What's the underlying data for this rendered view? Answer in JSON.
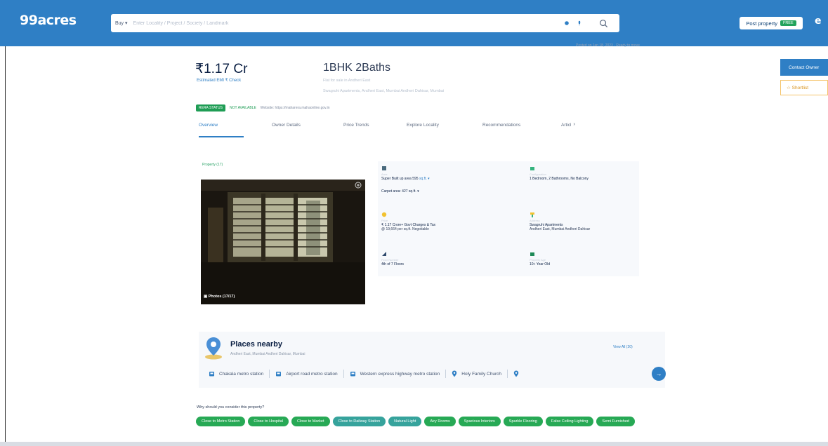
{
  "header": {
    "logo": "99acres",
    "buy_label": "Buy ▾",
    "search_placeholder": "Enter Locality / Project / Society / Landmark",
    "post_label": "Post property",
    "free_label": "FREE",
    "profile_glyph": "e"
  },
  "summary": {
    "posted": "Posted on Jan 18, 2023 · Ready to move",
    "price": "₹1.17 Cr",
    "emi": "Estimated EMI ₹ Check",
    "bhk": "1BHK 2Baths",
    "bhk_sub1": "Flat for sale in Andheri East",
    "bhk_sub2": "Swagruhi Apartments, Andheri East, Mumbai Andheri Dahisar, Mumbai",
    "rera_badge": "RERA STATUS",
    "rera_avail": "NOT AVAILABLE",
    "rera_link": "Website: https://maharera.mahaonline.gov.in"
  },
  "side": {
    "contact": "Contact Owner",
    "shortlist": "☆ Shortlist"
  },
  "tabs": [
    "Overview",
    "Owner Details",
    "Price Trends",
    "Explore Locality",
    "Recommendations",
    "Articl"
  ],
  "gallery": {
    "label": "Property (17)",
    "photos": "Photos (17/17)"
  },
  "details": {
    "area_label": "Area",
    "area_value": "Super Built up area 595",
    "area_unit": "sq.ft. ▾",
    "carpet": "Carpet area: 427 sq.ft. ▾",
    "config_label": "Configuration",
    "config_value": "1 Bedroom, 2 Bathrooms, No Balcony",
    "price_label": "Price",
    "price_value": "₹ 1.17 Crore+ Govt Charges & Tax",
    "price_sub": "@ 19,664 per sq.ft. Negotiable",
    "address_label": "Address",
    "address_value": "Swagruhi Apartments",
    "address_sub": "Andheri East, Mumbai Andheri Dahisar",
    "floor_label": "Floor Number",
    "floor_value": "4th of 7 Floors",
    "age_label": "Property Age",
    "age_value": "10+ Year Old"
  },
  "places": {
    "title": "Places nearby",
    "subtitle": "Andheri East, Mumbai Andheri Dahisar, Mumbai",
    "view_all": "View All (20)",
    "items": [
      "Chakala metro station",
      "Airport road metro station",
      "Western express highway metro station",
      "Holy Family Church"
    ]
  },
  "why": {
    "title": "Why should you consider this property?",
    "chips": [
      "Close to Metro Station",
      "Close to Hospital",
      "Close to Market",
      "Close to Railway Station",
      "Natural Light",
      "Airy Rooms",
      "Spacious Interiors",
      "Sparkle Flooring",
      "False Ceiling Lighting",
      "Semi Furnished"
    ]
  },
  "colors": {
    "brand_blue": "#2f7fc5",
    "green": "#27a955",
    "teal": "#36a39c"
  }
}
